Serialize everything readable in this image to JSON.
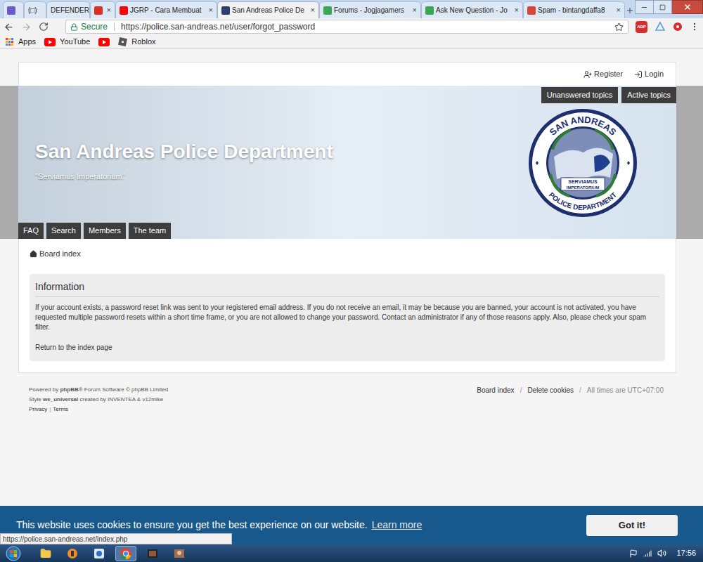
{
  "browser": {
    "tabs": [
      {
        "color": "#6a5acd",
        "selected": false,
        "closable": false
      },
      {
        "title": "(□)",
        "color": "#888888",
        "selected": false,
        "closable": false
      },
      {
        "title": "DEFENDER",
        "color": "#2f6fcb",
        "selected": false,
        "closable": false
      },
      {
        "color": "#d93025",
        "selected": false,
        "closable": true
      },
      {
        "title": "JGRP - Cara Membuat",
        "color": "#ff0000",
        "selected": false,
        "closable": true
      },
      {
        "title": "San Andreas Police De",
        "color": "#2c3e70",
        "selected": true,
        "closable": true
      },
      {
        "title": "Forums - Jogjagamers",
        "color": "#3aa655",
        "selected": false,
        "closable": true
      },
      {
        "title": "Ask New Question - Jo",
        "color": "#3aa655",
        "selected": false,
        "closable": true
      },
      {
        "title": "Spam - bintangdaffa8",
        "color": "#d44638",
        "selected": false,
        "closable": true
      }
    ],
    "tab_close": "×",
    "address": {
      "secure": "Secure",
      "url": "https://police.san-andreas.net/user/forgot_password"
    },
    "extensions": {
      "abp": "ABP"
    },
    "bookmarks": [
      {
        "label": "Apps",
        "kind": "apps"
      },
      {
        "label": "YouTube",
        "kind": "youtube"
      },
      {
        "kind": "youtube"
      },
      {
        "label": "Roblox",
        "kind": "roblox"
      }
    ]
  },
  "page": {
    "user_links": [
      {
        "label": "Register",
        "kind": "register"
      },
      {
        "label": "Login",
        "kind": "login"
      }
    ],
    "quick_links": [
      "Unanswered topics",
      "Active topics"
    ],
    "site_title": "San Andreas Police Department",
    "site_motto": "\"Serviamus Imperatorium\"",
    "logo": {
      "top": "SAN ANDREAS",
      "bottom": "POLICE DEPARTMENT",
      "motto_1": "SERVIAMUS",
      "motto_2": "IMPERATORIUM"
    },
    "nav": [
      "FAQ",
      "Search",
      "Members",
      "The team"
    ],
    "breadcrumb": "Board index",
    "panel": {
      "title": "Information",
      "message": "If your account exists, a password reset link was sent to your registered email address. If you do not receive an email, it may be because you are banned, your account is not activated, you have requested multiple password resets within a short time frame, or you are not allowed to change your password. Contact an administrator if any of those reasons apply. Also, please check your spam filter.",
      "link": "Return to the index page"
    },
    "footer": {
      "powered": [
        {
          "text": "Powered by ",
          "bold": false
        },
        {
          "text": "phpBB",
          "bold": true
        },
        {
          "text": "® Forum Software © phpBB Limited",
          "bold": false
        }
      ],
      "style": [
        {
          "text": "Style ",
          "bold": false
        },
        {
          "text": "we_universal",
          "bold": true
        },
        {
          "text": " created by INVENTEA & v12mike",
          "bold": false
        }
      ],
      "legal": [
        "Privacy",
        "Terms"
      ],
      "legal_separator": "|",
      "links": [
        "Board index",
        "Delete cookies"
      ],
      "link_separator": "/",
      "timezone": "All times are UTC+07:00"
    }
  },
  "cookie_notice": {
    "message": "This website uses cookies to ensure you get the best experience on our website.",
    "link": "Learn more",
    "button": "Got it!"
  },
  "status_url": "https://police.san-andreas.net/index.php",
  "taskbar": {
    "apps": [
      {
        "kind": "explorer",
        "selected": false
      },
      {
        "kind": "fl",
        "selected": false
      },
      {
        "kind": "app",
        "selected": false
      },
      {
        "kind": "chrome",
        "selected": true
      },
      {
        "kind": "media",
        "selected": false
      },
      {
        "kind": "photo",
        "selected": false
      }
    ],
    "time": "17:56"
  }
}
